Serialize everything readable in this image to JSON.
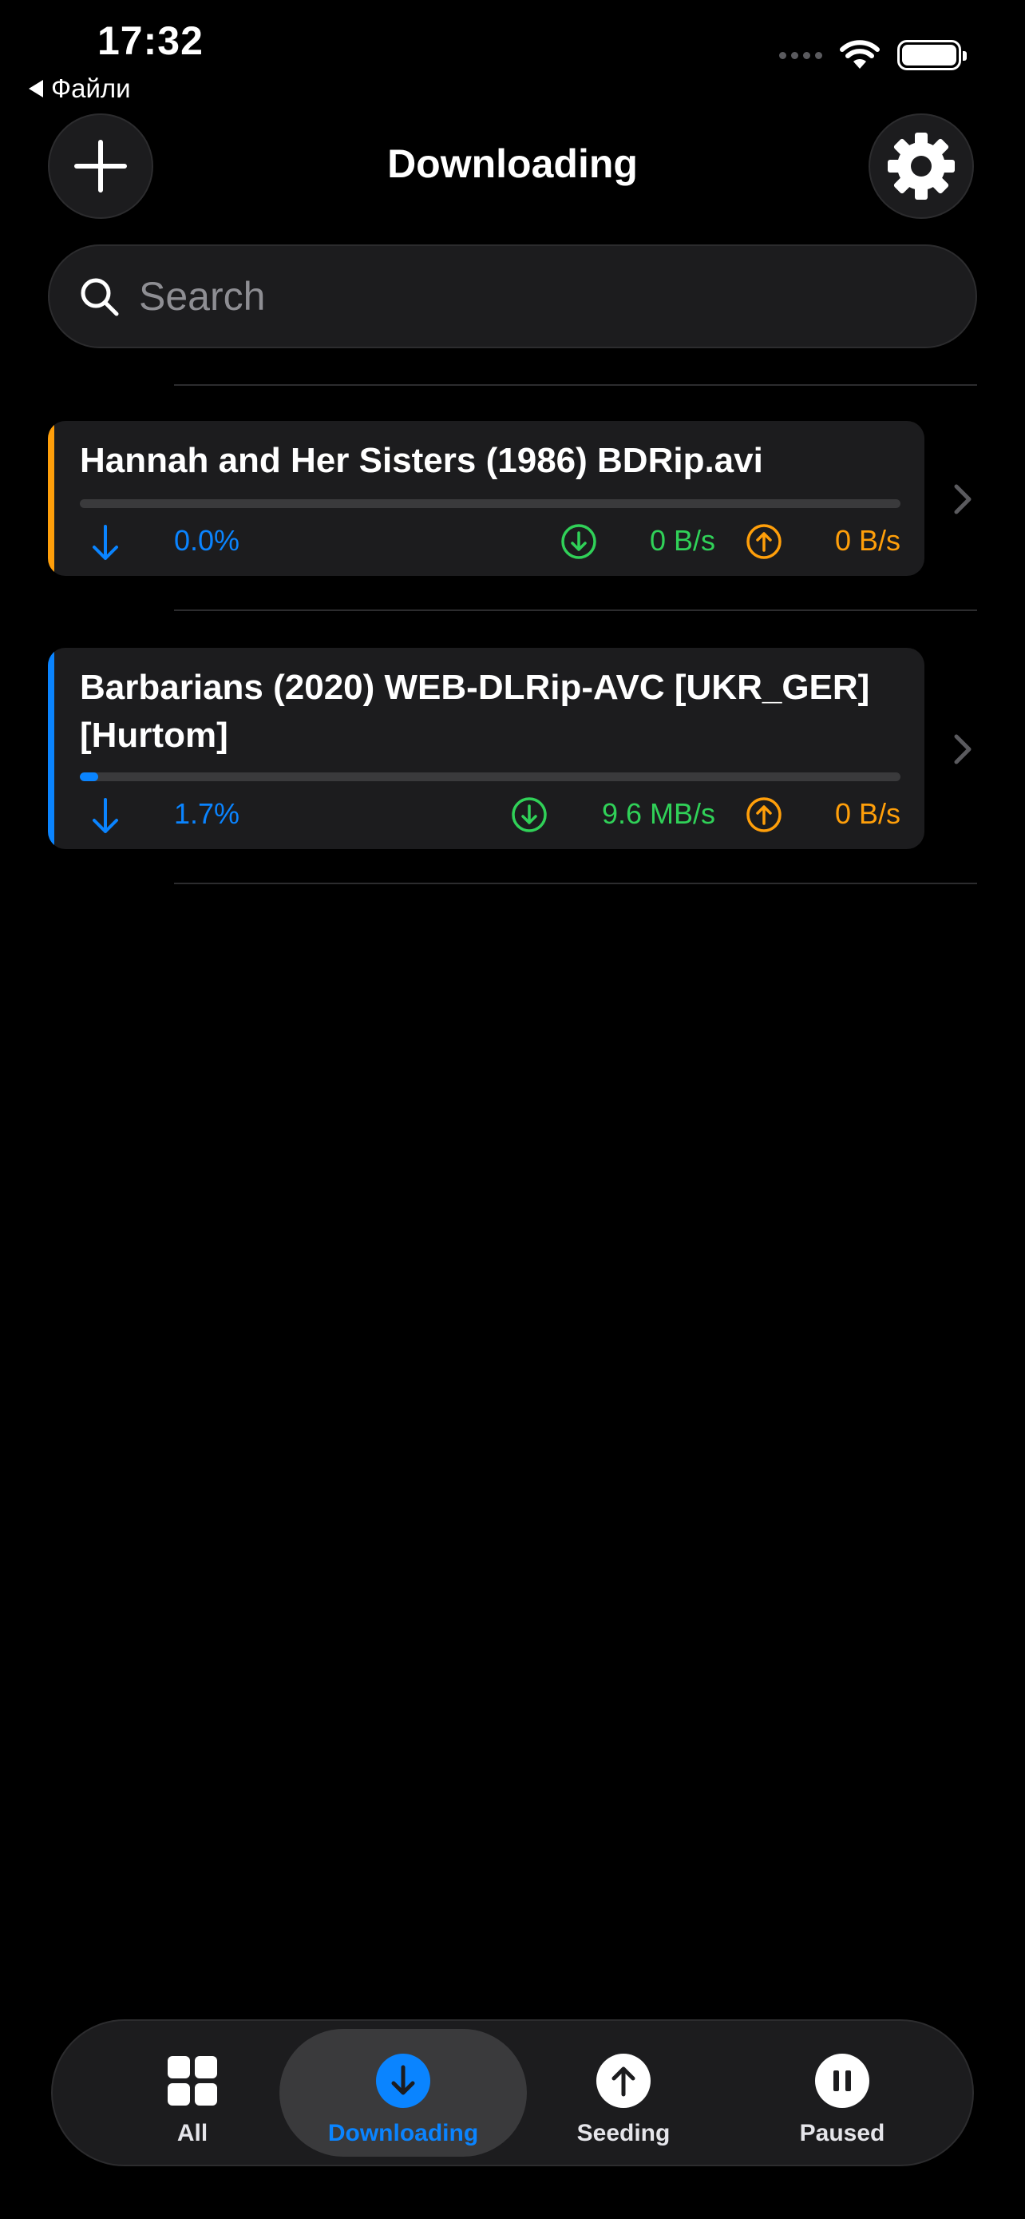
{
  "status_bar": {
    "time": "17:32",
    "back_label": "Файли"
  },
  "header": {
    "title": "Downloading",
    "add_icon": "plus-icon",
    "settings_icon": "gear-icon"
  },
  "search": {
    "placeholder": "Search",
    "value": ""
  },
  "torrents": [
    {
      "name": "Hannah and Her Sisters (1986) BDRip.avi",
      "progress_label": "0.0%",
      "progress": 0.0,
      "download_rate": "0 B/s",
      "upload_rate": "0 B/s",
      "accent_color": "#ff9f0a"
    },
    {
      "name": "Barbarians (2020) WEB-DLRip-AVC [UKR_GER] [Hurtom]",
      "progress_label": "1.7%",
      "progress": 0.017,
      "download_rate": "9.6 MB/s",
      "upload_rate": "0 B/s",
      "accent_color": "#0a84ff"
    }
  ],
  "tabs": [
    {
      "label": "All",
      "icon": "grid-icon",
      "active": false
    },
    {
      "label": "Downloading",
      "icon": "arrow-down-circle-icon",
      "active": true
    },
    {
      "label": "Seeding",
      "icon": "arrow-up-circle-icon",
      "active": false
    },
    {
      "label": "Paused",
      "icon": "pause-circle-icon",
      "active": false
    }
  ],
  "colors": {
    "accent_blue": "#0a84ff",
    "download_green": "#30d158",
    "upload_orange": "#ff9f0a",
    "surface": "#1c1c1e"
  }
}
